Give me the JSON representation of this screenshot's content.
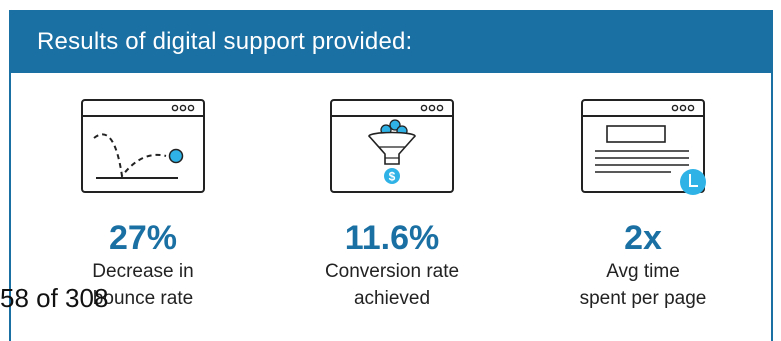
{
  "header": {
    "title": "Results of digital support provided:"
  },
  "stats": [
    {
      "value": "27%",
      "label_line1": "Decrease in",
      "label_line2": "bounce rate",
      "icon": "browser-bounce-icon"
    },
    {
      "value": "11.6%",
      "label_line1": "Conversion rate",
      "label_line2": "achieved",
      "icon": "browser-funnel-icon"
    },
    {
      "value": "2x",
      "label_line1": "Avg time",
      "label_line2": "spent per page",
      "icon": "browser-clock-icon"
    }
  ],
  "page_number": "58 of 308",
  "colors": {
    "brand": "#1a6fa3",
    "accent": "#2fb3e6"
  }
}
